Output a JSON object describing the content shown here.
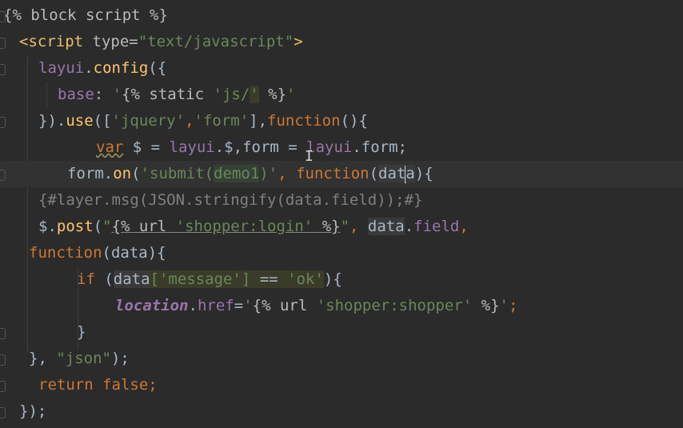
{
  "lines": [
    {
      "tokens": [
        {
          "t": "{% block script %}",
          "c": "k-attr"
        }
      ]
    },
    {
      "tokens": [
        {
          "t": "<script",
          "c": "k-tag"
        },
        {
          "t": " type=",
          "c": "k-attr"
        },
        {
          "t": "\"text/javascript\"",
          "c": "k-string"
        },
        {
          "t": ">",
          "c": "k-tag"
        }
      ]
    },
    {
      "tokens": [
        {
          "t": "layui",
          "c": "k-prop"
        },
        {
          "t": ".",
          "c": ""
        },
        {
          "t": "config",
          "c": "k-func"
        },
        {
          "t": "({",
          "c": ""
        }
      ]
    },
    {
      "tokens": [
        {
          "t": "base",
          "c": "k-prop"
        },
        {
          "t": ": ",
          "c": ""
        },
        {
          "t": "'",
          "c": "k-string"
        },
        {
          "t": "{% static ",
          "c": "k-attr"
        },
        {
          "t": "'js/",
          "c": "k-string"
        },
        {
          "t": "'",
          "c": "k-string hl-olive"
        },
        {
          "t": " %}",
          "c": "k-attr"
        },
        {
          "t": "'",
          "c": "k-string"
        }
      ]
    },
    {
      "tokens": [
        {
          "t": "}).",
          "c": ""
        },
        {
          "t": "use",
          "c": "k-func"
        },
        {
          "t": "([",
          "c": ""
        },
        {
          "t": "'jquery'",
          "c": "k-string"
        },
        {
          "t": ",",
          "c": "k-keyword"
        },
        {
          "t": "'form'",
          "c": "k-string"
        },
        {
          "t": "],",
          "c": ""
        },
        {
          "t": "function",
          "c": "k-keyword"
        },
        {
          "t": "(){",
          "c": ""
        }
      ]
    },
    {
      "tokens": [
        {
          "t": "var",
          "c": "k-keyword k-squig"
        },
        {
          "t": " $ = ",
          "c": ""
        },
        {
          "t": "layui",
          "c": "k-prop"
        },
        {
          "t": ".$,",
          "c": ""
        },
        {
          "t": "form",
          "c": ""
        },
        {
          "t": " = ",
          "c": ""
        },
        {
          "t": "layui",
          "c": "k-prop"
        },
        {
          "t": ".form;",
          "c": ""
        }
      ]
    },
    {
      "tokens": [
        {
          "t": "form",
          "c": ""
        },
        {
          "t": ".",
          "c": ""
        },
        {
          "t": "on",
          "c": "k-func"
        },
        {
          "t": "(",
          "c": ""
        },
        {
          "t": "'submit(",
          "c": "k-string"
        },
        {
          "t": "demo1",
          "c": "k-string hl-green"
        },
        {
          "t": ")'",
          "c": "k-string"
        },
        {
          "t": ", ",
          "c": "k-keyword"
        },
        {
          "t": "function",
          "c": "k-keyword"
        },
        {
          "t": "(",
          "c": ""
        },
        {
          "t": "dat",
          "c": "hl-dark"
        },
        {
          "t": "CURSOR",
          "c": "cursor"
        },
        {
          "t": "a",
          "c": "hl-dark"
        },
        {
          "t": "){",
          "c": ""
        }
      ]
    },
    {
      "tokens": [
        {
          "t": "{#layer.msg(JSON.stringify(data.field));#}",
          "c": "k-dim"
        }
      ]
    },
    {
      "tokens": [
        {
          "t": "$",
          "c": ""
        },
        {
          "t": ".",
          "c": ""
        },
        {
          "t": "post",
          "c": "k-func"
        },
        {
          "t": "(",
          "c": ""
        },
        {
          "t": "\"",
          "c": "k-string"
        },
        {
          "t": "{% url ",
          "c": "k-attr k-under"
        },
        {
          "t": "'shopper:login'",
          "c": "k-string k-under"
        },
        {
          "t": " %}",
          "c": "k-attr k-under"
        },
        {
          "t": "\"",
          "c": "k-string"
        },
        {
          "t": ", ",
          "c": "k-keyword"
        },
        {
          "t": "data",
          "c": "hl-dark"
        },
        {
          "t": ".",
          "c": ""
        },
        {
          "t": "field",
          "c": "k-prop"
        },
        {
          "t": ",",
          "c": "k-keyword"
        }
      ]
    },
    {
      "tokens": [
        {
          "t": "function",
          "c": "k-keyword"
        },
        {
          "t": "(data){",
          "c": ""
        }
      ]
    },
    {
      "tokens": [
        {
          "t": "if",
          "c": "k-keyword"
        },
        {
          "t": " (",
          "c": ""
        },
        {
          "t": "data",
          "c": "hl-dark"
        },
        {
          "t": "['message']",
          "c": "k-string hl-olive"
        },
        {
          "t": " == ",
          "c": "hl-olive"
        },
        {
          "t": "'ok'",
          "c": "k-string hl-olive"
        },
        {
          "t": "){",
          "c": ""
        }
      ]
    },
    {
      "tokens": [
        {
          "t": "location",
          "c": "k-ital"
        },
        {
          "t": ".",
          "c": ""
        },
        {
          "t": "href",
          "c": "k-prop"
        },
        {
          "t": "=",
          "c": ""
        },
        {
          "t": "'",
          "c": "k-string"
        },
        {
          "t": "{% url ",
          "c": "k-attr"
        },
        {
          "t": "'shopper:shopper'",
          "c": "k-string"
        },
        {
          "t": " %}",
          "c": "k-attr"
        },
        {
          "t": "'",
          "c": "k-string"
        },
        {
          "t": ";",
          "c": "k-keyword"
        }
      ]
    },
    {
      "tokens": [
        {
          "t": "}",
          "c": ""
        }
      ]
    },
    {
      "tokens": [
        {
          "t": "}, ",
          "c": ""
        },
        {
          "t": "\"json\"",
          "c": "k-string"
        },
        {
          "t": ");",
          "c": ""
        }
      ]
    },
    {
      "tokens": [
        {
          "t": "return false",
          "c": "k-keyword"
        },
        {
          "t": ";",
          "c": "k-keyword"
        }
      ]
    },
    {
      "tokens": [
        {
          "t": "});",
          "c": ""
        }
      ]
    }
  ]
}
